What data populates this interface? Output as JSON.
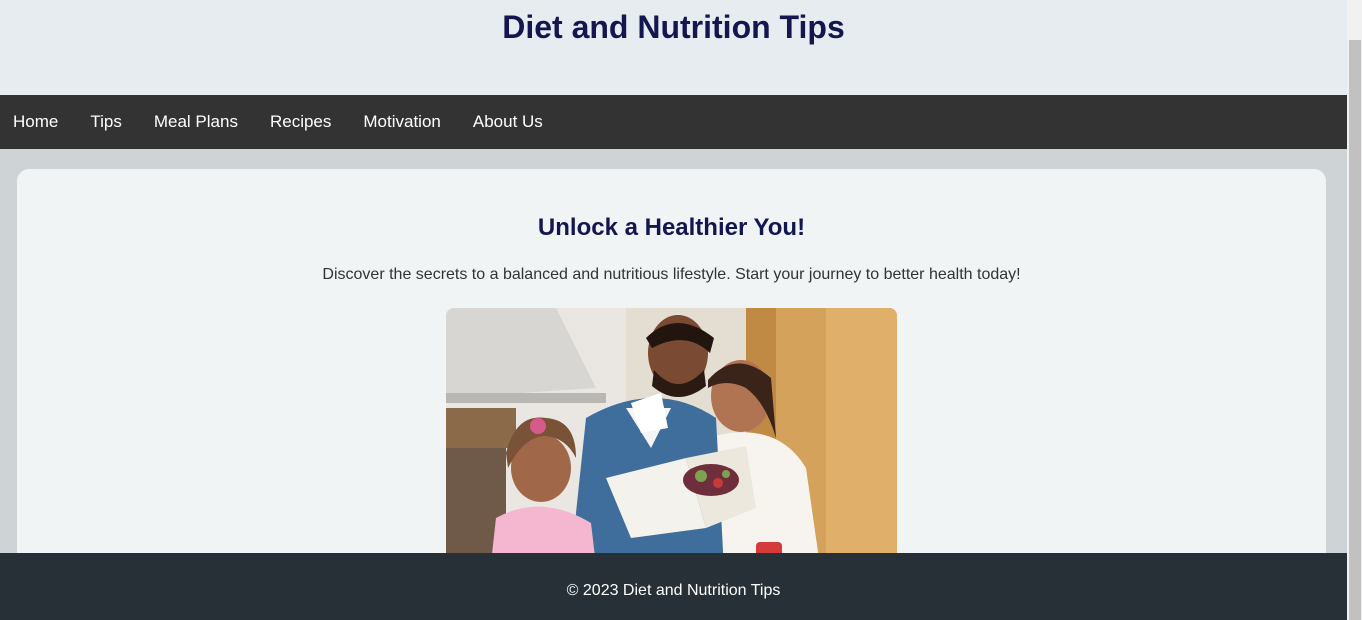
{
  "header": {
    "title": "Diet and Nutrition Tips"
  },
  "nav": {
    "items": [
      {
        "label": "Home"
      },
      {
        "label": "Tips"
      },
      {
        "label": "Meal Plans"
      },
      {
        "label": "Recipes"
      },
      {
        "label": "Motivation"
      },
      {
        "label": "About Us"
      }
    ]
  },
  "hero": {
    "heading": "Unlock a Healthier You!",
    "text": "Discover the secrets to a balanced and nutritious lifestyle. Start your journey to better health today!"
  },
  "footer": {
    "text": "© 2023 Diet and Nutrition Tips"
  }
}
